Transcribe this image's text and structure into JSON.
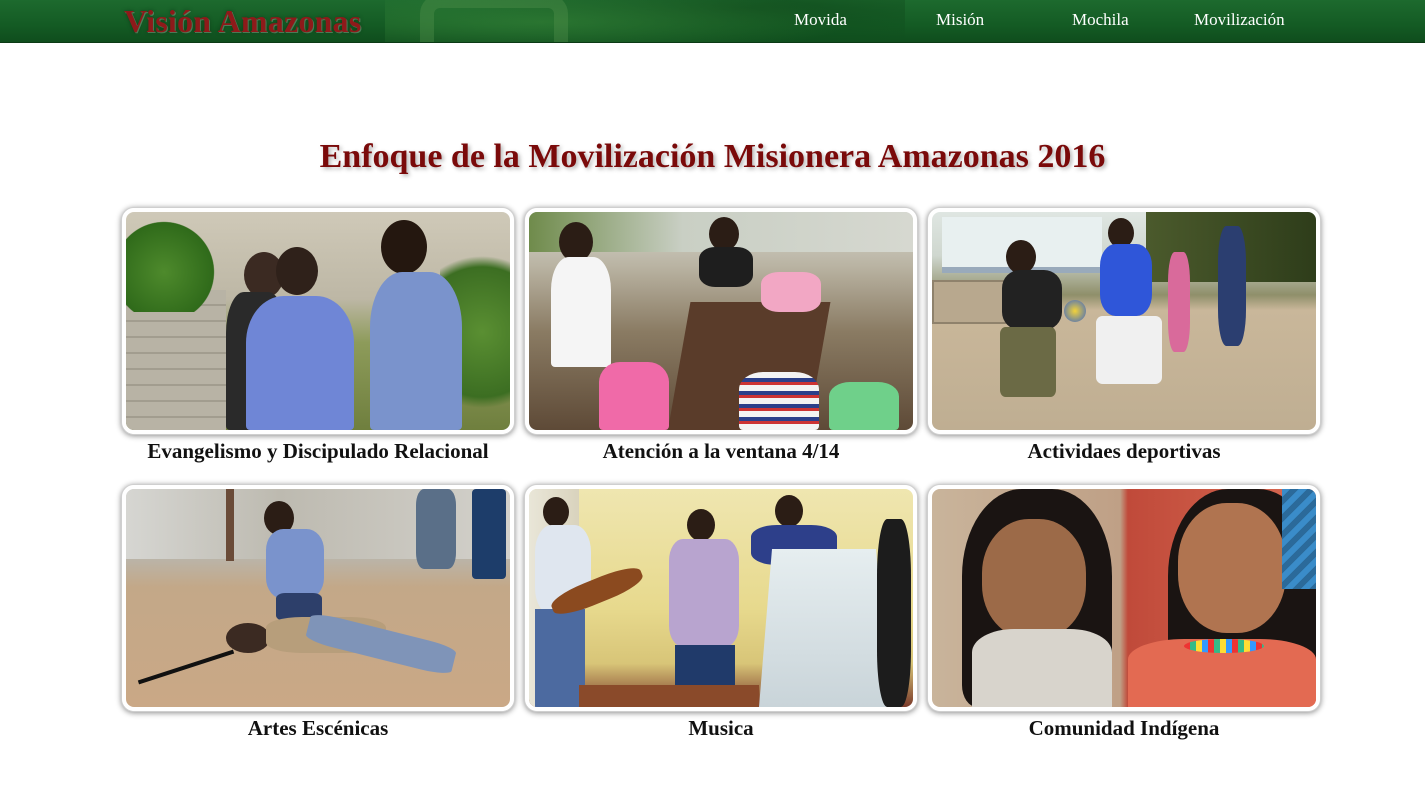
{
  "header": {
    "brand": "Visión Amazonas",
    "nav": [
      {
        "label": "Movida"
      },
      {
        "label": "Misión"
      },
      {
        "label": "Mochila"
      },
      {
        "label": "Movilización"
      }
    ]
  },
  "main": {
    "title": "Enfoque de la Movilización Misionera Amazonas 2016",
    "cards": [
      {
        "caption": "Evangelismo y Discipulado Relacional",
        "image": "evangelism-photo"
      },
      {
        "caption": "Atención a la ventana 4/14",
        "image": "children-table-photo"
      },
      {
        "caption": "Actividaes deportivas",
        "image": "sports-photo"
      },
      {
        "caption": "Artes Escénicas",
        "image": "drama-photo"
      },
      {
        "caption": "Musica",
        "image": "music-worship-photo"
      },
      {
        "caption": "Comunidad Indígena",
        "image": "indigenous-girls-photo"
      }
    ]
  },
  "colors": {
    "header_green": "#145b24",
    "brand_red": "#8e1a1a",
    "title_red": "#7a0a0a"
  }
}
